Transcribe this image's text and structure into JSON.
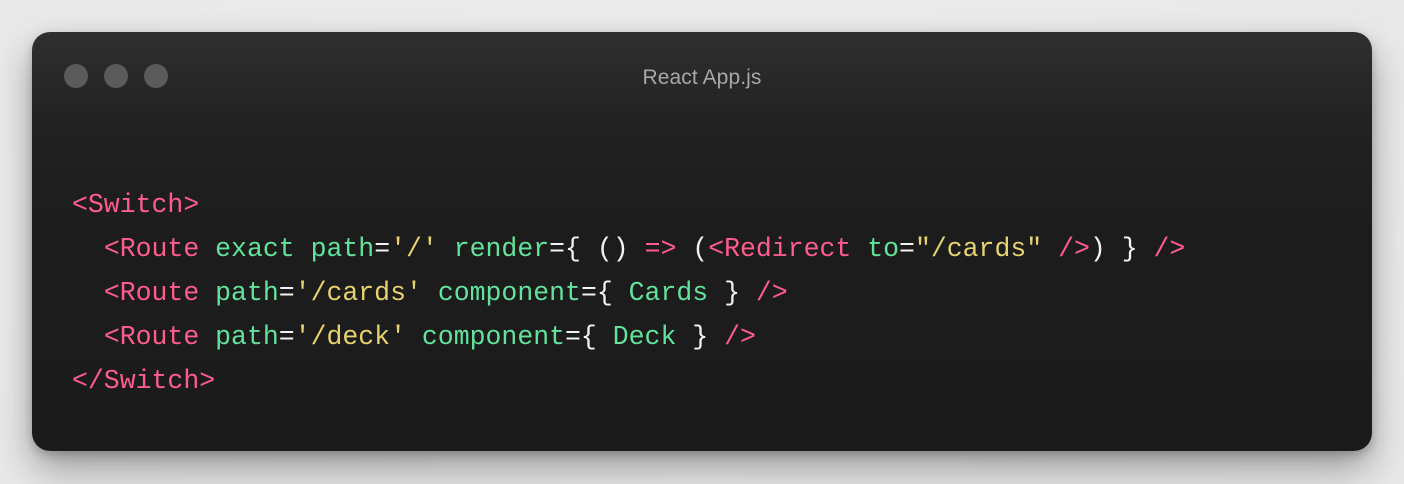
{
  "window": {
    "title": "React App.js"
  },
  "code": {
    "language": "jsx",
    "lines": [
      [
        {
          "t": "<Switch>",
          "k": "tag"
        }
      ],
      [
        {
          "t": "  ",
          "k": "punc"
        },
        {
          "t": "<Route",
          "k": "tag"
        },
        {
          "t": " ",
          "k": "punc"
        },
        {
          "t": "exact",
          "k": "attr"
        },
        {
          "t": " ",
          "k": "punc"
        },
        {
          "t": "path",
          "k": "attr"
        },
        {
          "t": "=",
          "k": "punc"
        },
        {
          "t": "'/'",
          "k": "str"
        },
        {
          "t": " ",
          "k": "punc"
        },
        {
          "t": "render",
          "k": "attr"
        },
        {
          "t": "={ () ",
          "k": "punc"
        },
        {
          "t": "=>",
          "k": "op"
        },
        {
          "t": " (",
          "k": "punc"
        },
        {
          "t": "<Redirect",
          "k": "tag"
        },
        {
          "t": " ",
          "k": "punc"
        },
        {
          "t": "to",
          "k": "attr"
        },
        {
          "t": "=",
          "k": "punc"
        },
        {
          "t": "\"/cards\"",
          "k": "str"
        },
        {
          "t": " ",
          "k": "punc"
        },
        {
          "t": "/>",
          "k": "tag"
        },
        {
          "t": ") } ",
          "k": "punc"
        },
        {
          "t": "/>",
          "k": "tag"
        }
      ],
      [
        {
          "t": "  ",
          "k": "punc"
        },
        {
          "t": "<Route",
          "k": "tag"
        },
        {
          "t": " ",
          "k": "punc"
        },
        {
          "t": "path",
          "k": "attr"
        },
        {
          "t": "=",
          "k": "punc"
        },
        {
          "t": "'/cards'",
          "k": "str"
        },
        {
          "t": " ",
          "k": "punc"
        },
        {
          "t": "component",
          "k": "attr"
        },
        {
          "t": "={ ",
          "k": "punc"
        },
        {
          "t": "Cards",
          "k": "comp"
        },
        {
          "t": " } ",
          "k": "punc"
        },
        {
          "t": "/>",
          "k": "tag"
        }
      ],
      [
        {
          "t": "  ",
          "k": "punc"
        },
        {
          "t": "<Route",
          "k": "tag"
        },
        {
          "t": " ",
          "k": "punc"
        },
        {
          "t": "path",
          "k": "attr"
        },
        {
          "t": "=",
          "k": "punc"
        },
        {
          "t": "'/deck'",
          "k": "str"
        },
        {
          "t": " ",
          "k": "punc"
        },
        {
          "t": "component",
          "k": "attr"
        },
        {
          "t": "={ ",
          "k": "punc"
        },
        {
          "t": "Deck",
          "k": "comp"
        },
        {
          "t": " } ",
          "k": "punc"
        },
        {
          "t": "/>",
          "k": "tag"
        }
      ],
      [
        {
          "t": "</Switch>",
          "k": "tag"
        }
      ]
    ]
  },
  "colors": {
    "background": "#1b1b1b",
    "tag": "#ff5c8d",
    "attribute": "#62e29b",
    "string": "#e6d370",
    "punctuation": "#f2f2f2",
    "window_dot": "#5b5b5b",
    "title_text": "#a8a8a8"
  }
}
